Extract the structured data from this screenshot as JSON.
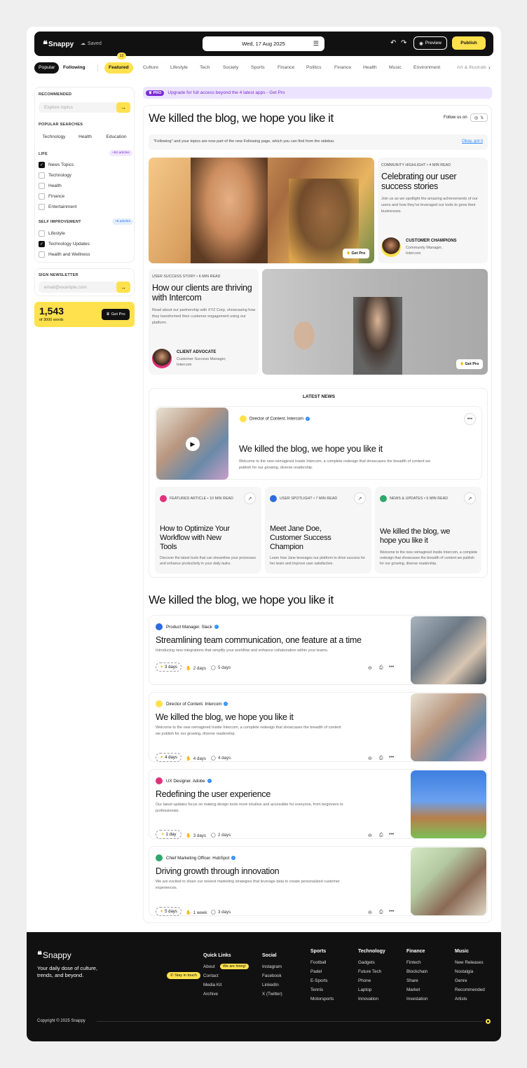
{
  "app": {
    "name": "Snappy",
    "saved": "Saved"
  },
  "topbar": {
    "date": "Wed, 17 Aug 2025",
    "preview": "Preview",
    "publish": "Publish"
  },
  "tabs": {
    "popular": "Popular",
    "following": "Following",
    "featured_badge": "12",
    "items": [
      "Featured",
      "Culture",
      "Lifestyle",
      "Tech",
      "Society",
      "Sports",
      "Finance",
      "Politics",
      "Finance",
      "Health",
      "Music",
      "Environment",
      "Art & Illustration"
    ]
  },
  "sidebar": {
    "recommended": "RECOMMENDED",
    "explore_placeholder": "Explore topics",
    "popular_searches": "POPULAR SEARCHES",
    "searches": [
      "Technology",
      "Health",
      "Education"
    ],
    "life": "LIFE",
    "life_count": "+50 articles",
    "life_items": [
      {
        "label": "News Topics",
        "checked": true
      },
      {
        "label": "Technology",
        "checked": false
      },
      {
        "label": "Health",
        "checked": false
      },
      {
        "label": "Finance",
        "checked": false
      },
      {
        "label": "Entertainment",
        "checked": false
      }
    ],
    "self_improvement": "SELF IMPROVEMENT",
    "self_count": "+5 articles",
    "self_items": [
      {
        "label": "Lifestyle",
        "checked": false
      },
      {
        "label": "Technology Updates",
        "checked": true
      },
      {
        "label": "Health and Wellness",
        "checked": false
      }
    ],
    "newsletter": "SIGN NEWSLETTER",
    "email_placeholder": "email@example.com",
    "words_count": "1,543",
    "words_total": "of 3000 words",
    "get_pro": "Get Pro"
  },
  "pro_banner": {
    "tag": "PRO",
    "text": "Upgrade for full access beyond the 4 latest apps - Get Pro"
  },
  "hero": {
    "title": "We killed the blog, we hope you like it",
    "follow": "Follow us on",
    "notice": "\"Following\" and your topics are now part of the new Following page, which you can find from the sidebar.",
    "notice_action": "Okay, got it"
  },
  "feature1": {
    "meta": "COMMUNITY HIGHLIGHT • 4 MIN READ",
    "title": "Celebrating our user success stories",
    "desc": "Join us as we spotlight the amazing achievements of our users and how they've leveraged our tools to grow their businesses.",
    "author_role": "CUSTOMER CHAMPIONS",
    "author_sub": "Community Manager, Intercom",
    "get_pro": "Get Pro"
  },
  "feature2": {
    "meta": "USER SUCCESS STORY • 6 MIN READ",
    "title": "How our clients are thriving with Intercom",
    "desc": "Read about our partnership with XYZ Corp, showcasing how they transformed their customer engagement using our platform.",
    "author_role": "CLIENT ADVOCATE",
    "author_sub": "Customer Success Manager, Intercom",
    "get_pro": "Get Pro"
  },
  "latest": {
    "heading": "LATEST NEWS",
    "main": {
      "author": "Director of Content. Intercom",
      "title": "We killed the blog, we hope you like it",
      "desc": "Welcome to the new reimagined Inside Intercom, a complete redesign that showcases the breadth of content we publish for our growing, diverse readership."
    },
    "cards": [
      {
        "meta": "FEATURED ARTICLE • 10 MIN READ",
        "title": "How to Optimize Your Workflow with New Tools",
        "desc": "Discover the latest tools that can streamline your processes and enhance productivity in your daily tasks."
      },
      {
        "meta": "USER SPOTLIGHT • 7 MIN READ",
        "title": "Meet Jane Doe, Customer Success Champion",
        "desc": "Learn how Jane leverages our platform to drive success for her team and improve user satisfaction."
      },
      {
        "meta": "NEWS & UPDATES • 5 MIN READ",
        "title": "We killed the blog, we hope you like it",
        "desc": "Welcome to the new reimagined Inside Intercom, a complete redesign that showcases the breadth of content we publish for our growing, diverse readership."
      }
    ]
  },
  "section2": {
    "title": "We killed the blog, we hope you like it",
    "posts": [
      {
        "author": "Product Manager. Slack",
        "title": "Streamlining team communication, one feature at a time",
        "desc": "Introducing new integrations that simplify your workflow and enhance collaboration within your teams.",
        "tag": "3 days",
        "likes": "2 days",
        "comments": "5 days"
      },
      {
        "author": "Director of Content. Intercom",
        "title": "We killed the blog, we hope you like it",
        "desc": "Welcome to the new reimagined Inside Intercom, a complete redesign that showcases the breadth of content we publish for our growing, diverse readership.",
        "tag": "4 days",
        "likes": "4 days",
        "comments": "4 days"
      },
      {
        "author": "UX Designer. Adobe",
        "title": "Redefining the user experience",
        "desc": "Our latest updates focus on making design tools more intuitive and accessible for everyone, from beginners to professionals.",
        "tag": "1 day",
        "likes": "3 days",
        "comments": "2 days"
      },
      {
        "author": "Chief Marketing Officer. HubSpot",
        "title": "Driving growth through innovation",
        "desc": "We are excited to share our newest marketing strategies that leverage data to create personalized customer experiences.",
        "tag": "5 days",
        "likes": "1 week",
        "comments": "3 days"
      }
    ]
  },
  "footer": {
    "brand": "Snappy",
    "tagline": "Your daily dose of culture, trends, and beyond.",
    "stay": "Stay in touch",
    "quick_links": {
      "title": "Quick Links",
      "items": [
        "About",
        "Contact",
        "Media Kit",
        "Archive"
      ],
      "hiring": "We are hiring!"
    },
    "social": {
      "title": "Social",
      "items": [
        "Instagram",
        "Facebook",
        "LinkedIn",
        "X (Twitter)"
      ]
    },
    "sports": {
      "title": "Sports",
      "items": [
        "Football",
        "Padel",
        "E-Sports",
        "Tennis",
        "Motorsports"
      ]
    },
    "technology": {
      "title": "Technology",
      "items": [
        "Gadgets",
        "Future Tech",
        "Phone",
        "Laptop",
        "Innovation"
      ]
    },
    "finance": {
      "title": "Finance",
      "items": [
        "Fintech",
        "Blockchain",
        "Share",
        "Market",
        "Investation"
      ]
    },
    "music": {
      "title": "Music",
      "items": [
        "New Releases",
        "Nostalgia",
        "Genre",
        "Recommended",
        "Artists"
      ]
    },
    "copyright": "Copyright © 2025 Snappy"
  }
}
